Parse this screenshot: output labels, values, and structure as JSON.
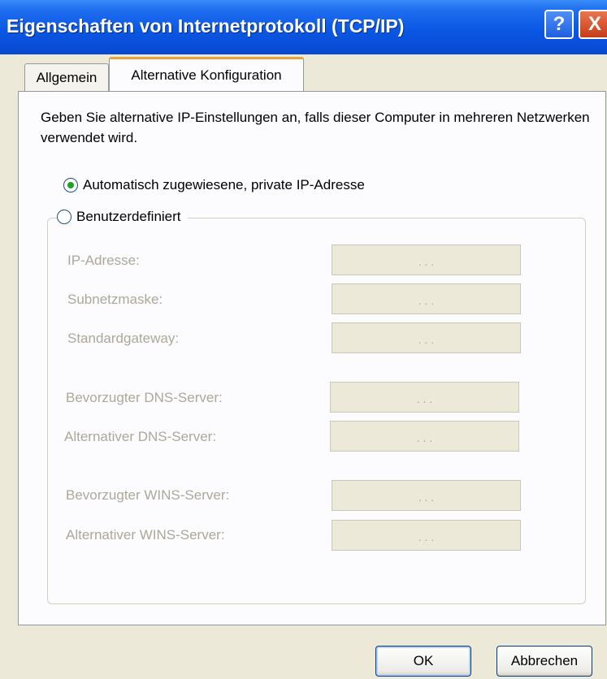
{
  "window": {
    "title": "Eigenschaften von Internetprotokoll (TCP/IP)",
    "help_glyph": "?",
    "close_glyph": "X"
  },
  "tabs": [
    {
      "label": "Allgemein",
      "active": false
    },
    {
      "label": "Alternative Konfiguration",
      "active": true
    }
  ],
  "description": "Geben Sie alternative IP-Einstellungen an, falls dieser Computer in mehreren Netzwerken verwendet wird.",
  "options": {
    "auto_label": "Automatisch zugewiesene, private IP-Adresse",
    "auto_selected": true,
    "custom_label": "Benutzerdefiniert",
    "custom_selected": false
  },
  "fields": [
    {
      "label": "IP-Adresse:",
      "value": ". . ."
    },
    {
      "label": "Subnetzmaske:",
      "value": ". . ."
    },
    {
      "label": "Standardgateway:",
      "value": ". . ."
    },
    {
      "label": "Bevorzugter DNS-Server:",
      "value": ". . ."
    },
    {
      "label": "Alternativer DNS-Server:",
      "value": ". . ."
    },
    {
      "label": "Bevorzugter WINS-Server:",
      "value": ". . ."
    },
    {
      "label": "Alternativer WINS-Server:",
      "value": ". . ."
    }
  ],
  "buttons": {
    "ok": "OK",
    "cancel": "Abbrechen"
  },
  "colors": {
    "titlebar": "#0a58e4",
    "active_tab_accent": "#e8a33a",
    "radio_dot": "#21a121",
    "disabled_text": "#aca899"
  }
}
